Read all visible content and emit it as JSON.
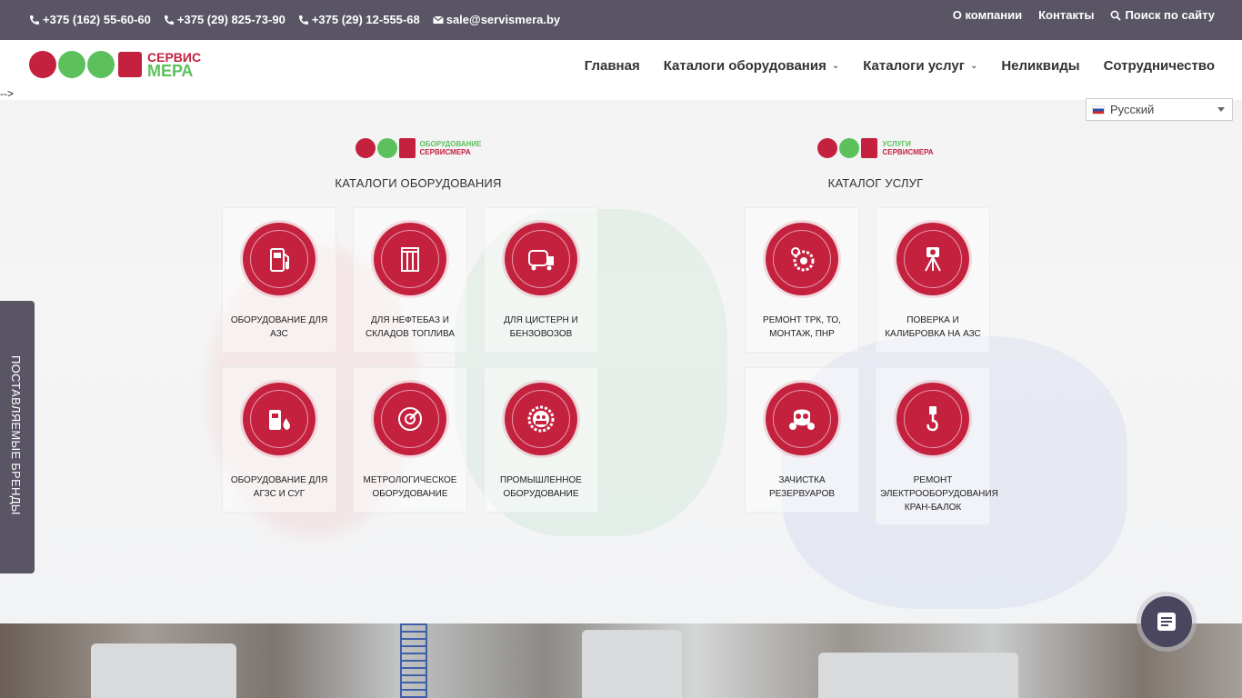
{
  "topbar": {
    "phones": [
      "+375 (162) 55-60-60",
      "+375 (29) 825-73-90",
      "+375 (29) 12-555-68"
    ],
    "email": "sale@servismera.by",
    "links": [
      "О компании",
      "Контакты",
      "Поиск по сайту"
    ]
  },
  "header": {
    "logo_top": "СЕРВИС",
    "logo_bottom": "МЕРА",
    "nav": [
      "Главная",
      "Каталоги оборудования",
      "Каталоги услуг",
      "Неликвиды",
      "Сотрудничество"
    ],
    "stray_text": "-->"
  },
  "language": {
    "selected": "Русский"
  },
  "equipment": {
    "logo_a": "ОБОРУДОВАНИЕ",
    "logo_b": "СЕРВИСМЕРА",
    "title": "КАТАЛОГИ ОБОРУДОВАНИЯ",
    "cards": [
      "ОБОРУДОВАНИЕ ДЛЯ АЗС",
      "ДЛЯ НЕФТЕБАЗ И СКЛАДОВ ТОПЛИВА",
      "ДЛЯ ЦИСТЕРН И БЕНЗОВОЗОВ",
      "ОБОРУДОВАНИЕ ДЛЯ АГЗС И СУГ",
      "МЕТРОЛОГИЧЕСКОЕ ОБОРУДОВАНИЕ",
      "ПРОМЫШЛЕННОЕ ОБОРУДОВАНИЕ"
    ]
  },
  "services": {
    "logo_a": "УСЛУГИ",
    "logo_b": "СЕРВИСМЕРА",
    "title": "КАТАЛОГ УСЛУГ",
    "cards": [
      "РЕМОНТ ТРК, ТО, МОНТАЖ, ПНР",
      "ПОВЕРКА И КАЛИБРОВКА НА АЗС",
      "ЗАЧИСТКА РЕЗЕРВУАРОВ",
      "РЕМОНТ ЭЛЕКТРООБОРУДОВАНИЯ КРАН-БАЛОК"
    ]
  },
  "side_tab": {
    "label": "ПОСТАВЛЯЕМЫЕ БРЕНДЫ"
  },
  "colors": {
    "accent": "#c4213f",
    "green": "#5cc15d",
    "topbar": "#5a5564"
  }
}
